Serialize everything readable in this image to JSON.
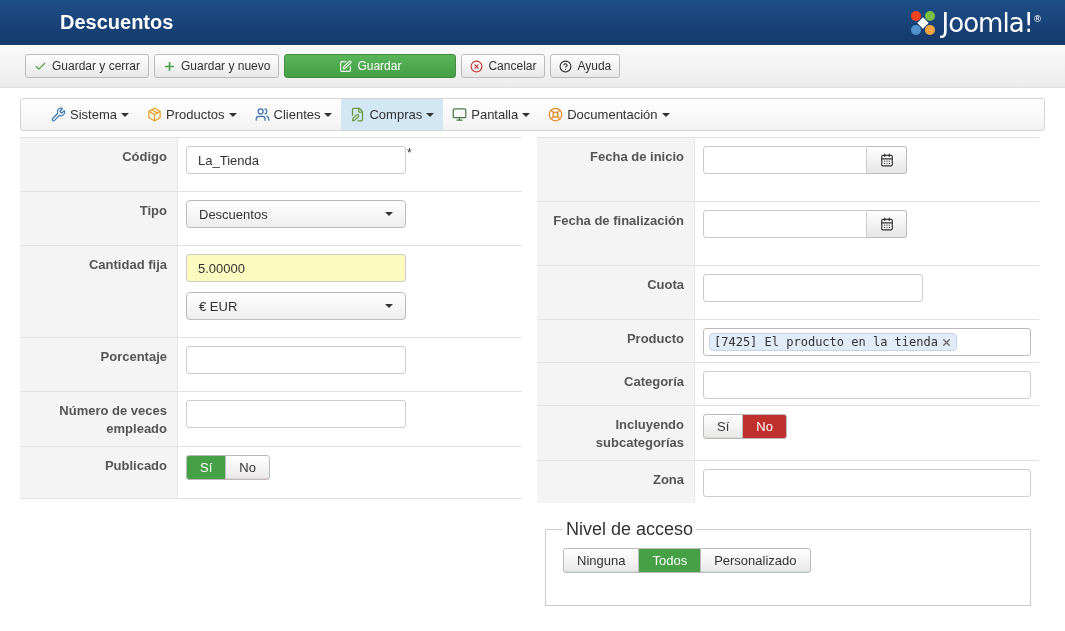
{
  "header": {
    "title": "Descuentos",
    "logo_text": "Joomla!$^{®}$"
  },
  "toolbar": [
    {
      "label": "Guardar y cerrar",
      "kind": "default"
    },
    {
      "label": "Guardar y nuevo",
      "kind": "default"
    },
    {
      "label": "Guardar",
      "kind": "primary"
    },
    {
      "label": "Cancelar",
      "kind": "default"
    },
    {
      "label": "Ayuda",
      "kind": "default"
    }
  ],
  "menu": [
    {
      "label": "Sistema",
      "selected": false
    },
    {
      "label": "Productos",
      "selected": false
    },
    {
      "label": "Clientes",
      "selected": false
    },
    {
      "label": "Compras",
      "selected": true
    },
    {
      "label": "Pantalla",
      "selected": false
    },
    {
      "label": "Documentación",
      "selected": false
    }
  ],
  "left_form": [
    {
      "label": "Código",
      "controls": [
        {
          "kind": "text",
          "value": "La_Tienda",
          "required_mark": "*"
        }
      ]
    },
    {
      "label": "Tipo",
      "controls": [
        {
          "kind": "select",
          "value": "Descuentos"
        }
      ]
    },
    {
      "label": "Cantidad fija",
      "controls": [
        {
          "kind": "text",
          "value": "5.00000",
          "highlighted": true
        },
        {
          "kind": "select",
          "value": "€ EUR"
        }
      ]
    },
    {
      "label": "Porcentaje",
      "controls": [
        {
          "kind": "text"
        }
      ]
    },
    {
      "label": "Número de veces empleado",
      "controls": [
        {
          "kind": "text"
        }
      ]
    },
    {
      "label": "Publicado",
      "controls": [
        {
          "kind": "toggle",
          "options": [
            {
              "label": "Sí",
              "selected": true,
              "kind": "positive"
            },
            {
              "label": "No",
              "selected": false,
              "kind": "negative"
            }
          ]
        }
      ]
    }
  ],
  "right_form": [
    {
      "label": "Fecha de inicio",
      "controls": [
        {
          "kind": "date"
        }
      ]
    },
    {
      "label": "Fecha de finalización",
      "controls": [
        {
          "kind": "date"
        }
      ]
    },
    {
      "label": "Cuota",
      "controls": [
        {
          "kind": "text"
        }
      ]
    },
    {
      "label": "Producto",
      "controls": [
        {
          "kind": "tags",
          "tags": [
            "[7425] El producto en la tienda"
          ]
        }
      ]
    },
    {
      "label": "Categoría",
      "controls": [
        {
          "kind": "wide"
        }
      ]
    },
    {
      "label": "Incluyendo subcategorías",
      "controls": [
        {
          "kind": "toggle",
          "options": [
            {
              "label": "Sí",
              "selected": false,
              "kind": "positive"
            },
            {
              "label": "No",
              "selected": true,
              "kind": "negative"
            }
          ]
        }
      ]
    },
    {
      "label": "Zona",
      "controls": [
        {
          "kind": "wide"
        }
      ]
    }
  ],
  "access": {
    "legend": "Nivel de acceso",
    "options": [
      {
        "label": "Ninguna",
        "selected": false,
        "kind": "positive"
      },
      {
        "label": "Todos",
        "selected": true,
        "kind": "positive"
      },
      {
        "label": "Personalizado",
        "selected": false,
        "kind": "positive"
      }
    ]
  }
}
